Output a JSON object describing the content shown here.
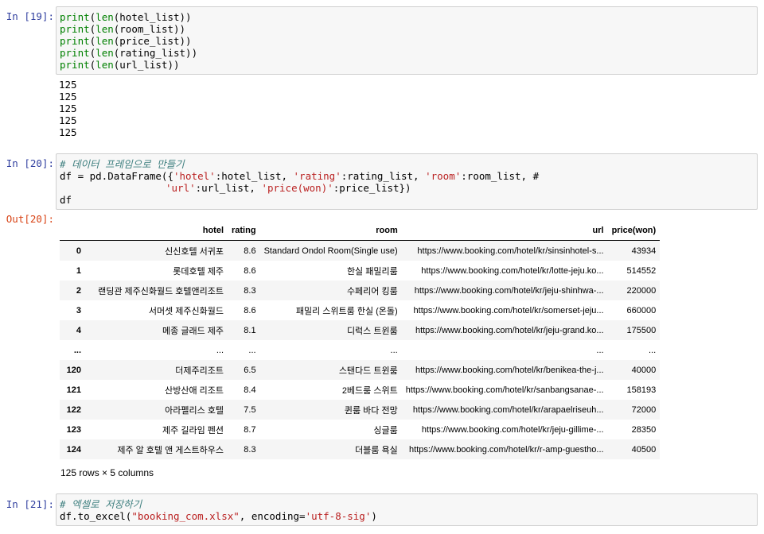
{
  "cells": [
    {
      "prompt": "In [19]:",
      "lines": [
        [
          "print",
          "(",
          "len",
          "(hotel_list))"
        ],
        [
          "print",
          "(",
          "len",
          "(room_list))"
        ],
        [
          "print",
          "(",
          "len",
          "(price_list))"
        ],
        [
          "print",
          "(",
          "len",
          "(rating_list))"
        ],
        [
          "print",
          "(",
          "len",
          "(url_list))"
        ]
      ],
      "output": [
        "125",
        "125",
        "125",
        "125",
        "125"
      ]
    },
    {
      "prompt": "In [20]:",
      "comment": "# 데이터 프레임으로 만들기",
      "line2": {
        "a": "df = pd.DataFrame({",
        "s1": "'hotel'",
        "b": ":hotel_list, ",
        "s2": "'rating'",
        "c": ":rating_list, ",
        "s3": "'room'",
        "d": ":room_list, ",
        "e": "#"
      },
      "line3": {
        "s4": "'url'",
        "f": ":url_list, ",
        "s5": "'price(won)'",
        "g": ":price_list})"
      },
      "line4": "df",
      "out_prompt": "Out[20]:"
    },
    {
      "prompt": "In [21]:",
      "comment": "# 엑셀로 저장하기",
      "line2": {
        "a": "df.to_excel(",
        "s1": "\"booking_com.xlsx\"",
        "b": ", encoding=",
        "s2": "'utf-8-sig'",
        "c": ")"
      }
    }
  ],
  "dataframe": {
    "columns": [
      "",
      "hotel",
      "rating",
      "room",
      "url",
      "price(won)"
    ],
    "rows": [
      [
        "0",
        "신신호텔 서귀포",
        "8.6",
        "Standard Ondol Room(Single use)",
        "https://www.booking.com/hotel/kr/sinsinhotel-s...",
        "43934"
      ],
      [
        "1",
        "롯데호텔 제주",
        "8.6",
        "한실 패밀리룸",
        "https://www.booking.com/hotel/kr/lotte-jeju.ko...",
        "514552"
      ],
      [
        "2",
        "랜딩관 제주신화월드 호텔앤리조트",
        "8.3",
        "수페리어 킹룸",
        "https://www.booking.com/hotel/kr/jeju-shinhwa-...",
        "220000"
      ],
      [
        "3",
        "서머셋 제주신화월드",
        "8.6",
        "패밀리 스위트룸 한실 (온돌)",
        "https://www.booking.com/hotel/kr/somerset-jeju...",
        "660000"
      ],
      [
        "4",
        "메종 글래드 제주",
        "8.1",
        "디럭스 트윈룸",
        "https://www.booking.com/hotel/kr/jeju-grand.ko...",
        "175500"
      ],
      [
        "...",
        "...",
        "...",
        "...",
        "...",
        "..."
      ],
      [
        "120",
        "더제주리조트",
        "6.5",
        "스탠다드 트윈룸",
        "https://www.booking.com/hotel/kr/benikea-the-j...",
        "40000"
      ],
      [
        "121",
        "산방산애 리조트",
        "8.4",
        "2베드룸 스위트",
        "https://www.booking.com/hotel/kr/sanbangsanae-...",
        "158193"
      ],
      [
        "122",
        "아라펠리스 호텔",
        "7.5",
        "퀸룸 바다 전망",
        "https://www.booking.com/hotel/kr/arapaelriseuh...",
        "72000"
      ],
      [
        "123",
        "제주 길라임 펜션",
        "8.7",
        "싱글룸",
        "https://www.booking.com/hotel/kr/jeju-gillime-...",
        "28350"
      ],
      [
        "124",
        "제주 알 호텔 앤 게스트하우스",
        "8.3",
        "더블룸 욕실",
        "https://www.booking.com/hotel/kr/r-amp-guestho...",
        "40500"
      ]
    ],
    "footer": "125 rows × 5 columns"
  }
}
